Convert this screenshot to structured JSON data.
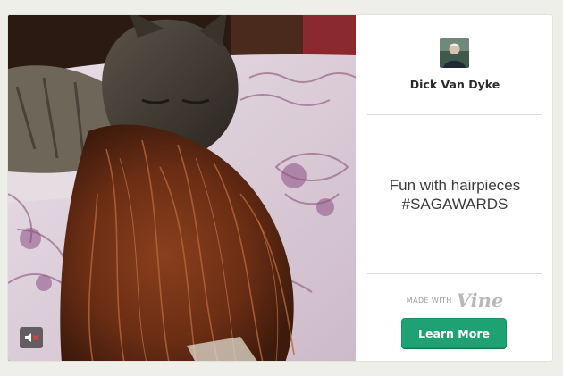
{
  "post": {
    "author": "Dick Van Dyke",
    "caption_line1": "Fun with hairpieces",
    "caption_line2": "#SAGAWARDS"
  },
  "branding": {
    "made_with_label": "MADE WITH",
    "logo_text": "Vine"
  },
  "actions": {
    "learn_more_label": "Learn More",
    "mute_icon": "speaker-muted-icon"
  },
  "colors": {
    "page_background": "#efefea",
    "card_background": "#ffffff",
    "button_green": "#1ea274",
    "logo_gray": "#b9b9b9"
  }
}
